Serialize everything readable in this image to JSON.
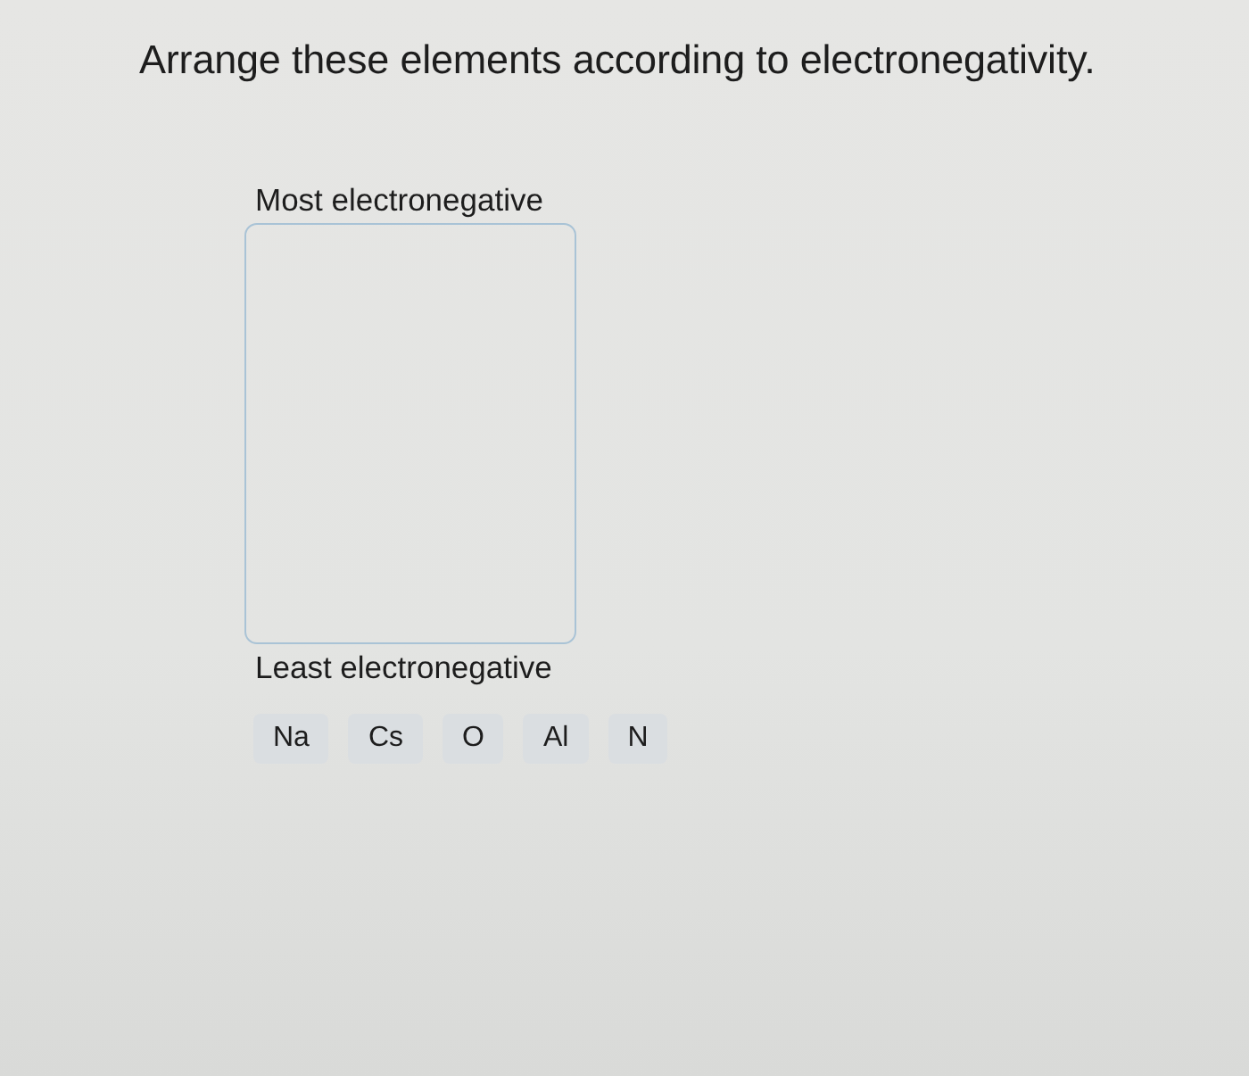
{
  "question": "Arrange these elements according to electronegativity.",
  "ranking": {
    "top_label": "Most electronegative",
    "bottom_label": "Least electronegative"
  },
  "tiles": [
    {
      "label": "Na"
    },
    {
      "label": "Cs"
    },
    {
      "label": "O"
    },
    {
      "label": "Al"
    },
    {
      "label": "N"
    }
  ]
}
